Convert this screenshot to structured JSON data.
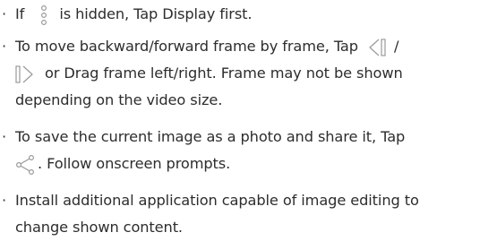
{
  "bullet_char": "·",
  "notes": {
    "n1": {
      "before": "If",
      "icon": "vertical-ellipsis-menu-icon",
      "after": "is hidden, Tap Display first."
    },
    "n2": {
      "line1": "To move backward/forward frame by frame, Tap",
      "icon_prev": "previous-frame-icon",
      "slash": "/",
      "icon_next": "next-frame-icon",
      "line2": "or Drag frame left/right. Frame may not be shown",
      "line3": "depending on the video size."
    },
    "n3": {
      "line1": "To save the current image as a photo and share it, Tap",
      "icon_share": "share-icon",
      "line2": ". Follow onscreen prompts."
    },
    "n4": {
      "line1": "Install additional application capable of image editing to",
      "line2": "change shown content."
    }
  }
}
